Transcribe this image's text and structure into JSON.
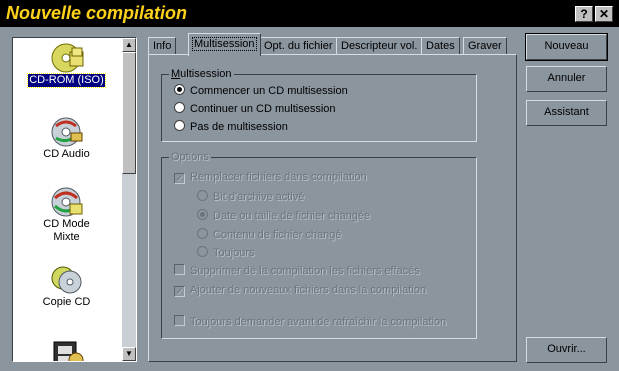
{
  "window": {
    "title": "Nouvelle compilation",
    "help_label": "?",
    "close_label": "✕"
  },
  "compilation_types": [
    {
      "label": "CD-ROM (ISO)",
      "icon": "cd-rom-iso-icon",
      "selected": true
    },
    {
      "label": "CD Audio",
      "icon": "cd-audio-icon",
      "selected": false
    },
    {
      "label": "CD Mode\nMixte",
      "icon": "cd-mixed-mode-icon",
      "selected": false
    },
    {
      "label": "Copie CD",
      "icon": "cd-copy-icon",
      "selected": false
    },
    {
      "label": "",
      "icon": "video-cd-icon",
      "selected": false
    }
  ],
  "tabs": [
    {
      "label": "Info"
    },
    {
      "label": "Multisession"
    },
    {
      "label": "Opt. du fichier"
    },
    {
      "label": "Descripteur vol."
    },
    {
      "label": "Dates"
    },
    {
      "label": "Graver"
    }
  ],
  "multisession": {
    "group_label": "Multisession",
    "options": [
      {
        "label": "Commencer un CD multisession",
        "selected": true
      },
      {
        "label": "Continuer un CD multisession",
        "selected": false
      },
      {
        "label": "Pas de multisession",
        "selected": false
      }
    ]
  },
  "options": {
    "group_label": "Options",
    "replace_files": {
      "label": "Remplacer fichiers dans compilation",
      "checked": true
    },
    "replace_modes": [
      {
        "label": "Bit d'archive activé",
        "selected": false
      },
      {
        "label": "Date ou taille de fichier changée",
        "selected": true
      },
      {
        "label": "Contenu de fichier changé",
        "selected": false
      },
      {
        "label": "Toujours",
        "selected": false
      }
    ],
    "delete_files": {
      "label": "Supprimer de la compilation les fichiers effacés",
      "checked": false
    },
    "add_files": {
      "label": "Ajouter de nouveaux fichiers dans la compilation",
      "checked": true
    },
    "always_ask": {
      "label": "Toujours demander avant de rafraîchir la compilation",
      "checked": false
    }
  },
  "buttons": {
    "new": "Nouveau",
    "cancel": "Annuler",
    "wizard": "Assistant",
    "open": "Ouvrir..."
  },
  "colors": {
    "background": "#8a959e",
    "title_text": "#ffd21a",
    "selection": "#000080"
  }
}
